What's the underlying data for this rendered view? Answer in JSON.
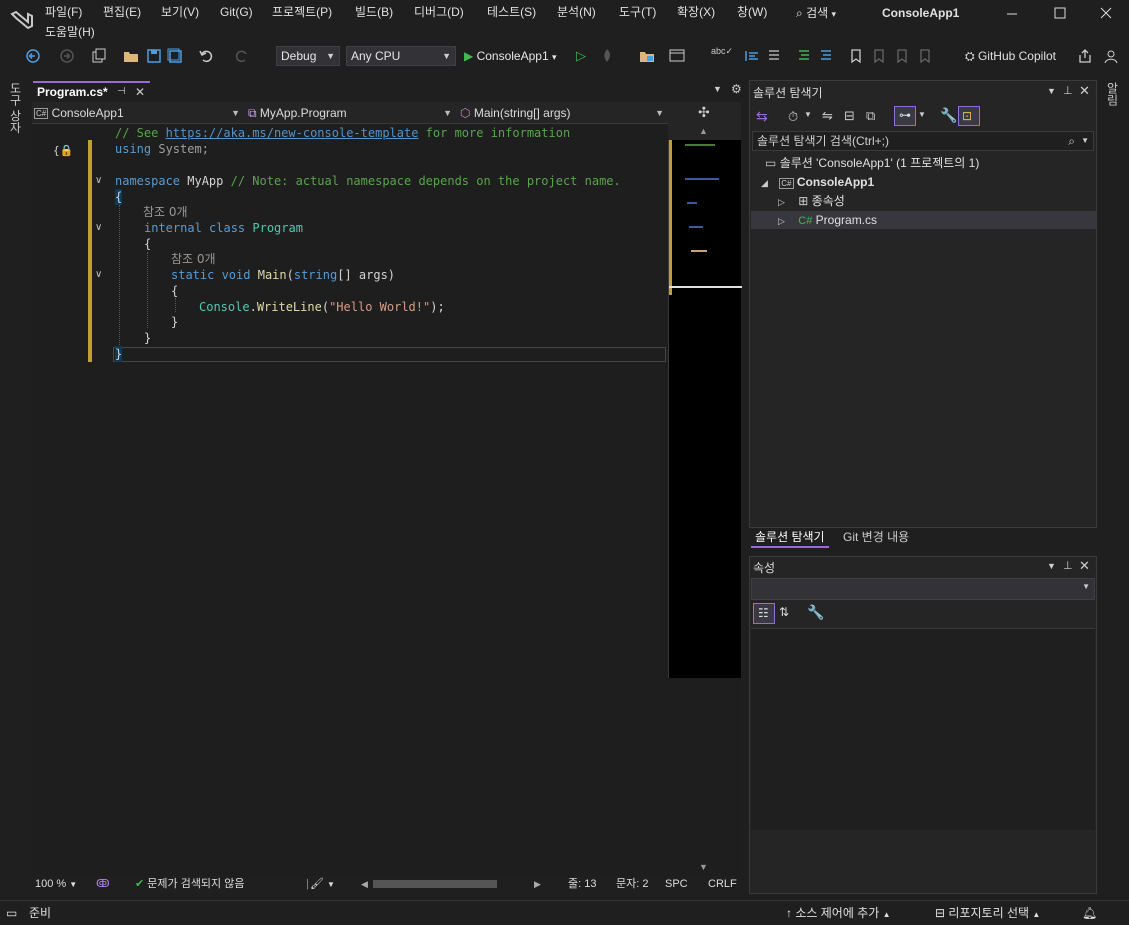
{
  "menu": {
    "items": [
      "파일(F)",
      "편집(E)",
      "보기(V)",
      "Git(G)",
      "프로젝트(P)",
      "빌드(B)",
      "디버그(D)",
      "테스트(S)",
      "분석(N)",
      "도구(T)",
      "확장(X)",
      "창(W)"
    ],
    "help": "도움말(H)",
    "search": "검색",
    "app_title": "ConsoleApp1"
  },
  "toolbar": {
    "config": "Debug",
    "platform": "Any CPU",
    "run_target": "ConsoleApp1",
    "copilot": "GitHub Copilot"
  },
  "left_strip": {
    "label": "도구 상자"
  },
  "right_strip": {
    "label": "알림"
  },
  "editor": {
    "tab_title": "Program.cs*",
    "nav": {
      "project": "ConsoleApp1",
      "type": "MyApp.Program",
      "member": "Main(string[] args)"
    },
    "lens_refs": "참조 0개",
    "code": {
      "l1_comment": "// See ",
      "l1_link": "https://aka.ms/new-console-template",
      "l1_rest": " for more information",
      "l2_kw": "using",
      "l2_rest": " System;",
      "l3_kw": "namespace",
      "l3_name": " MyApp ",
      "l3_comment": "// Note: actual namespace depends on the project name.",
      "open_brace": "{",
      "close_brace": "}",
      "cls_kw1": "internal",
      "cls_kw2": " class ",
      "cls_name": "Program",
      "m_kw1": "static",
      "m_kw2": " void ",
      "m_name": "Main",
      "m_args_open": "(",
      "m_args_type": "string",
      "m_args_rest": "[] args)",
      "call_type": "Console",
      "call_dot": ".",
      "call_method": "WriteLine",
      "call_open": "(",
      "call_str": "\"Hello World!\"",
      "call_close": ");"
    },
    "status": {
      "zoom": "100 %",
      "issues": "문제가 검색되지 않음",
      "line": "줄: 13",
      "col": "문자: 2",
      "spc": "SPC",
      "crlf": "CRLF"
    }
  },
  "solution_explorer": {
    "title": "솔루션 탐색기",
    "search_placeholder": "솔루션 탐색기 검색(Ctrl+;)",
    "tree": {
      "solution": "솔루션 'ConsoleApp1' (1 프로젝트의 1)",
      "project": "ConsoleApp1",
      "dependencies": "종속성",
      "file": "Program.cs"
    },
    "tabs": {
      "se": "솔루션 탐색기",
      "git": "Git 변경 내용"
    }
  },
  "properties": {
    "title": "속성"
  },
  "statusbar": {
    "ready": "준비",
    "source_control": "소스 제어에 추가",
    "repo": "리포지토리 선택"
  },
  "colors": {
    "accent": "#9a6bd6",
    "comment": "#57a64a",
    "keyword": "#569cd6",
    "type": "#4ec9b0",
    "method": "#dcdcaa",
    "string": "#d69d85",
    "change_bar": "#bfa130"
  }
}
